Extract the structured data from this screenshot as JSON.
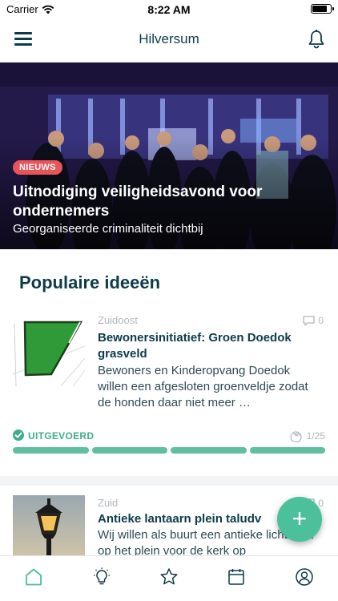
{
  "status_bar": {
    "carrier": "Carrier",
    "time": "8:22 AM"
  },
  "nav": {
    "title": "Hilversum",
    "menu_icon": "hamburger-menu-icon",
    "bell_icon": "bell-icon"
  },
  "hero": {
    "badge": "NIEUWS",
    "headline": "Uitnodiging veiligheidsavond voor ondernemers",
    "subline": "Georganiseerde criminaliteit dichtbij"
  },
  "section": {
    "title": "Populaire ideeën"
  },
  "ideas": [
    {
      "district": "Zuidoost",
      "comments": "0",
      "title": "Bewonersinitiatief: Groen Doedok grasveld",
      "description": "Bewoners en Kinderopvang Doedok willen een afgesloten groenveldje zodat de honden daar niet meer …",
      "status": "UITGEVOERD",
      "votes": "1/25",
      "progress": 1.0
    },
    {
      "district": "Zuid",
      "comments": "0",
      "title": "Antieke lantaarn plein taludv",
      "description": "Wij willen als buurt een antieke lichtmast op het plein voor de kerk op"
    }
  ],
  "colors": {
    "accent": "#4cbf9b",
    "badge": "#e8545a",
    "text": "#0d3b4a"
  },
  "fab": {
    "label": "+"
  },
  "tabs": [
    "home-icon",
    "ideas-lightbulb-icon",
    "star-icon",
    "calendar-icon",
    "profile-icon"
  ]
}
